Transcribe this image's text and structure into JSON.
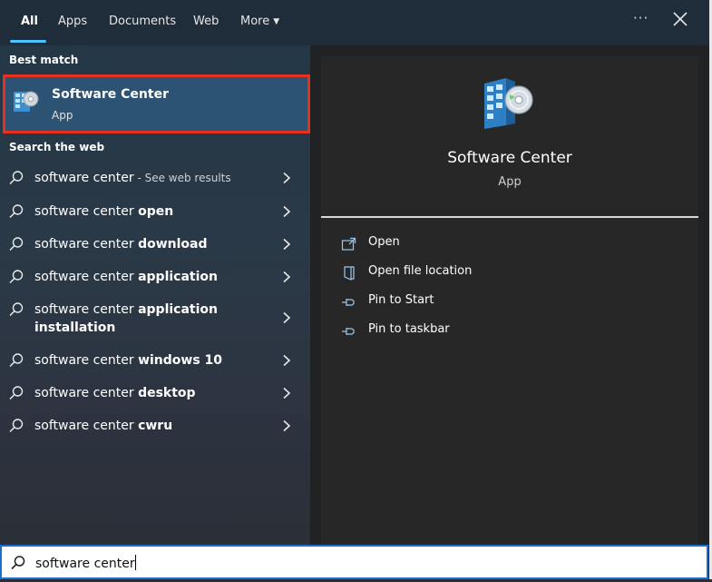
{
  "tabs": [
    {
      "label": "All"
    },
    {
      "label": "Apps"
    },
    {
      "label": "Documents"
    },
    {
      "label": "Web"
    },
    {
      "label": "More"
    }
  ],
  "top_actions": {
    "more_options": "···"
  },
  "left": {
    "best_match_heading": "Best match",
    "best_match": {
      "title": "Software Center",
      "subtitle": "App"
    },
    "web_heading": "Search the web",
    "suggestions": [
      {
        "prefix": "software center",
        "bold": "",
        "hint": " - See web results"
      },
      {
        "prefix": "software center ",
        "bold": "open",
        "hint": ""
      },
      {
        "prefix": "software center ",
        "bold": "download",
        "hint": ""
      },
      {
        "prefix": "software center ",
        "bold": "application",
        "hint": ""
      },
      {
        "prefix": "software center ",
        "bold": "application installation",
        "hint": ""
      },
      {
        "prefix": "software center ",
        "bold": "windows 10",
        "hint": ""
      },
      {
        "prefix": "software center ",
        "bold": "desktop",
        "hint": ""
      },
      {
        "prefix": "software center ",
        "bold": "cwru",
        "hint": ""
      }
    ]
  },
  "right": {
    "app_title": "Software Center",
    "app_type": "App",
    "actions": [
      {
        "label": "Open",
        "icon": "open-icon"
      },
      {
        "label": "Open file location",
        "icon": "file-location-icon"
      },
      {
        "label": "Pin to Start",
        "icon": "pin-icon"
      },
      {
        "label": "Pin to taskbar",
        "icon": "pin-icon"
      }
    ]
  },
  "search": {
    "value": "software center"
  },
  "colors": {
    "accent": "#4cc2ff",
    "highlight_border": "#e8301e",
    "selected_bg": "#2d5374"
  }
}
